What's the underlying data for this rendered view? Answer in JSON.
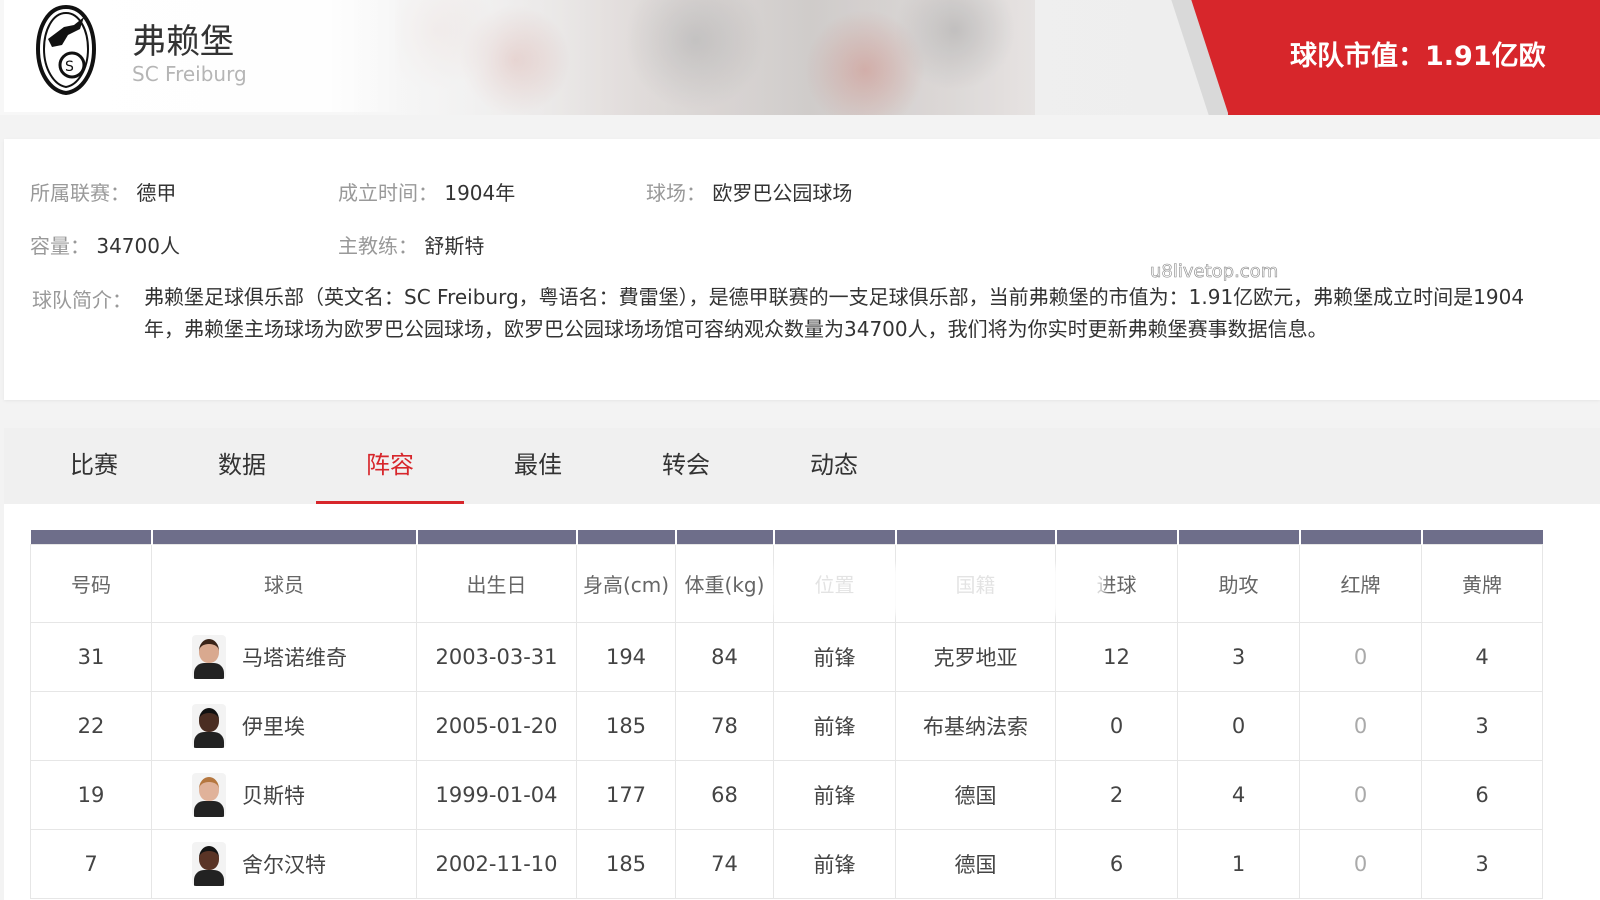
{
  "team": {
    "name_cn": "弗赖堡",
    "name_en": "SC Freiburg",
    "market_value": "球队市值：1.91亿欧"
  },
  "info": {
    "league_label": "所属联赛：",
    "league": "德甲",
    "founded_label": "成立时间：",
    "founded": "1904年",
    "stadium_label": "球场：",
    "stadium": "欧罗巴公园球场",
    "capacity_label": "容量：",
    "capacity": "34700人",
    "coach_label": "主教练：",
    "coach": "舒斯特",
    "intro_label": "球队简介：",
    "intro": "弗赖堡足球俱乐部（英文名：SC Freiburg，粤语名：費雷堡），是德甲联赛的一支足球俱乐部，当前弗赖堡的市值为：1.91亿欧元，弗赖堡成立时间是1904年，弗赖堡主场球场为欧罗巴公园球场，欧罗巴公园球场场馆可容纳观众数量为34700人，我们将为你实时更新弗赖堡赛事数据信息。",
    "watermark": "u8livetop.com"
  },
  "tabs": [
    {
      "label": "比赛",
      "active": false
    },
    {
      "label": "数据",
      "active": false
    },
    {
      "label": "阵容",
      "active": true
    },
    {
      "label": "最佳",
      "active": false
    },
    {
      "label": "转会",
      "active": false
    },
    {
      "label": "动态",
      "active": false
    }
  ],
  "table": {
    "headers": [
      "号码",
      "球员",
      "出生日",
      "身高(cm)",
      "体重(kg)",
      "位置",
      "国籍",
      "进球",
      "助攻",
      "红牌",
      "黄牌"
    ],
    "rows": [
      {
        "number": "31",
        "name": "马塔诺维奇",
        "birth": "2003-03-31",
        "height": "194",
        "weight": "84",
        "position": "前锋",
        "nation": "克罗地亚",
        "goals": "12",
        "assists": "3",
        "red": "0",
        "yellow": "4",
        "avatar_skin": "#d9a98f",
        "avatar_hair": "#3a2418"
      },
      {
        "number": "22",
        "name": "伊里埃",
        "birth": "2005-01-20",
        "height": "185",
        "weight": "78",
        "position": "前锋",
        "nation": "布基纳法索",
        "goals": "0",
        "assists": "0",
        "red": "0",
        "yellow": "3",
        "avatar_skin": "#4a2d22",
        "avatar_hair": "#111111"
      },
      {
        "number": "19",
        "name": "贝斯特",
        "birth": "1999-01-04",
        "height": "177",
        "weight": "68",
        "position": "前锋",
        "nation": "德国",
        "goals": "2",
        "assists": "4",
        "red": "0",
        "yellow": "6",
        "avatar_skin": "#e0b29a",
        "avatar_hair": "#b5773f"
      },
      {
        "number": "7",
        "name": "舍尔汉特",
        "birth": "2002-11-10",
        "height": "185",
        "weight": "74",
        "position": "前锋",
        "nation": "德国",
        "goals": "6",
        "assists": "1",
        "red": "0",
        "yellow": "3",
        "avatar_skin": "#5a3426",
        "avatar_hair": "#141414"
      }
    ]
  },
  "colors": {
    "accent": "#d7262b",
    "header_bar": "#6e6e8a"
  }
}
